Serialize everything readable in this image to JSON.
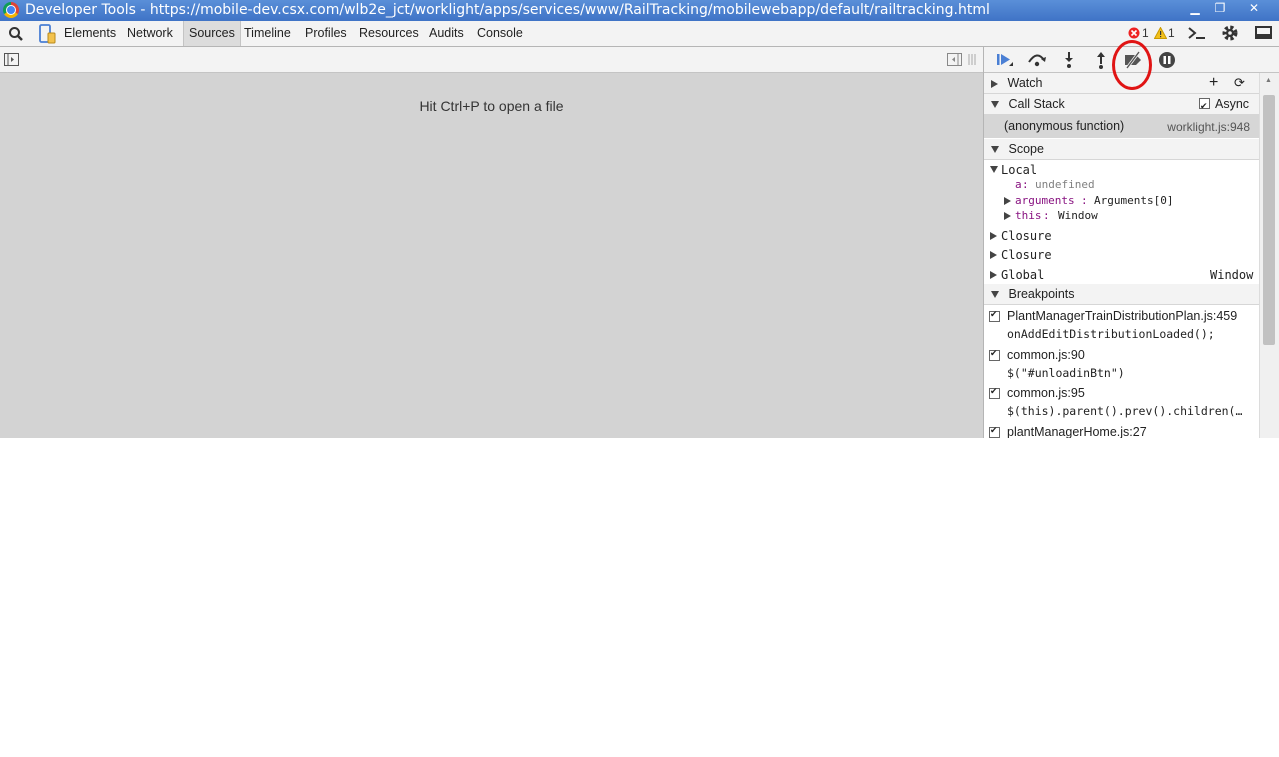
{
  "window": {
    "title": "Developer Tools - https://mobile-dev.csx.com/wlb2e_jct/worklight/apps/services/www/RailTracking/mobilewebapp/default/railtracking.html",
    "minimize_glyph": "▁",
    "maximize_glyph": "❐",
    "close_glyph": "✕"
  },
  "toolbar": {
    "tabs": [
      "Elements",
      "Network",
      "Sources",
      "Timeline",
      "Profiles",
      "Resources",
      "Audits",
      "Console"
    ],
    "selected_tab": "Sources",
    "error_count": "1",
    "warning_count": "1"
  },
  "editor": {
    "hint": "Hit Ctrl+P to open a file"
  },
  "sidebar": {
    "watch": {
      "title": "Watch"
    },
    "call_stack": {
      "title": "Call Stack",
      "async_label": "Async",
      "frames": [
        {
          "name": "(anonymous function)",
          "location": "worklight.js:948"
        }
      ]
    },
    "scope": {
      "title": "Scope",
      "local_label": "Local",
      "vars": [
        {
          "name": "a",
          "value": "undefined"
        },
        {
          "name": "arguments",
          "value": "Arguments[0]"
        },
        {
          "name": "this",
          "value": "Window"
        }
      ],
      "closures": [
        "Closure",
        "Closure"
      ],
      "global_label": "Global",
      "global_value": "Window"
    },
    "breakpoints": {
      "title": "Breakpoints",
      "items": [
        {
          "location": "PlantManagerTrainDistributionPlan.js:459",
          "code": "onAddEditDistributionLoaded();"
        },
        {
          "location": "common.js:90",
          "code": "$(\"#unloadinBtn\")"
        },
        {
          "location": "common.js:95",
          "code": "$(this).parent().prev().children(…"
        },
        {
          "location": "plantManagerHome.js:27",
          "code": ""
        }
      ]
    }
  },
  "colors": {
    "annotation": "#e01414",
    "accent_blue": "#4a7fd4"
  }
}
